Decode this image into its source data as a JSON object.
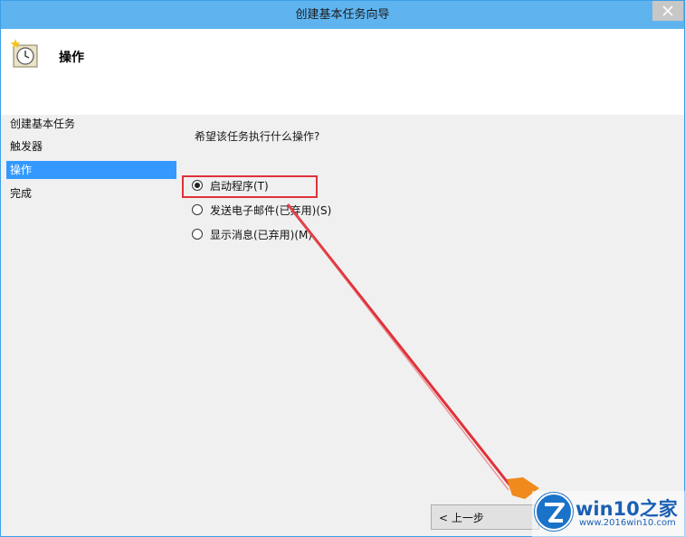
{
  "window": {
    "title": "创建基本任务向导"
  },
  "header": {
    "page_title": "操作",
    "icon": "task-clock-icon"
  },
  "sidebar": {
    "items": [
      {
        "label": "创建基本任务",
        "active": false
      },
      {
        "label": "触发器",
        "active": false
      },
      {
        "label": "操作",
        "active": true
      },
      {
        "label": "完成",
        "active": false
      }
    ]
  },
  "main": {
    "question": "希望该任务执行什么操作?",
    "options": [
      {
        "label": "启动程序(T)",
        "selected": true
      },
      {
        "label": "发送电子邮件(已弃用)(S)",
        "selected": false
      },
      {
        "label": "显示消息(已弃用)(M)",
        "selected": false
      }
    ]
  },
  "buttons": {
    "back_label": "< 上一步"
  },
  "watermark": {
    "brand": "win10之家",
    "url": "www.2016win10.com"
  },
  "colors": {
    "titlebar": "#5fb4f0",
    "selection": "#3399ff",
    "annotation": "#e0313a"
  }
}
